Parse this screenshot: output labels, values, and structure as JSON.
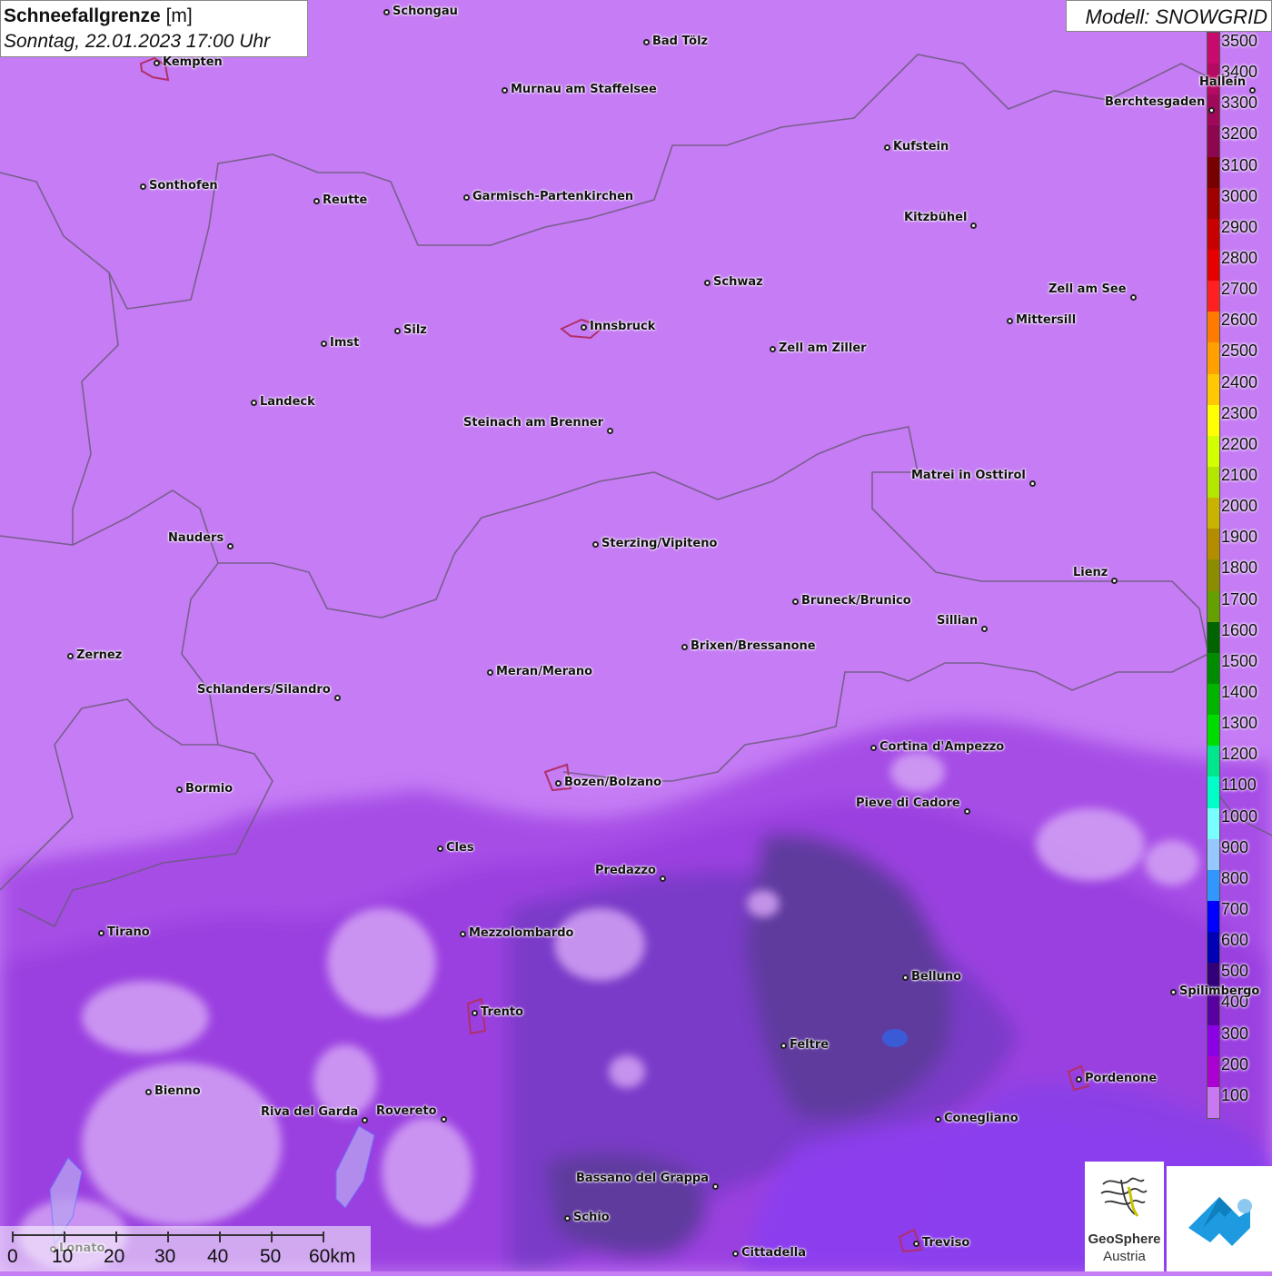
{
  "title": {
    "main": "Schneefallgrenze",
    "unit": "[m]",
    "datetime": "Sonntag, 22.01.2023 17:00 Uhr"
  },
  "model": "Modell: SNOWGRID",
  "legend": {
    "labels": [
      "3500",
      "3400",
      "3300",
      "3200",
      "3100",
      "3000",
      "2900",
      "2800",
      "2700",
      "2600",
      "2500",
      "2400",
      "2300",
      "2200",
      "2100",
      "2000",
      "1900",
      "1800",
      "1700",
      "1600",
      "1500",
      "1400",
      "1300",
      "1200",
      "1100",
      "1000",
      "900",
      "800",
      "700",
      "600",
      "500",
      "400",
      "300",
      "200",
      "100"
    ],
    "colors": [
      "#c80a6e",
      "#b40a64",
      "#a0085a",
      "#8c0650",
      "#780000",
      "#a00000",
      "#c80000",
      "#e60000",
      "#ff2020",
      "#ff7a00",
      "#ffa000",
      "#ffc800",
      "#ffff00",
      "#d4ff00",
      "#b4e600",
      "#c8b400",
      "#b48c00",
      "#8c8c00",
      "#64a000",
      "#006400",
      "#008c00",
      "#00b400",
      "#00dc00",
      "#00e68c",
      "#00ffc8",
      "#78ffff",
      "#96c8ff",
      "#3296ff",
      "#0000ff",
      "#0000b4",
      "#320078",
      "#5a00a0",
      "#8c00e6",
      "#aa00d2",
      "#c878f0"
    ]
  },
  "scale": {
    "labels": [
      "0",
      "10",
      "20",
      "30",
      "40",
      "50",
      "60km"
    ]
  },
  "logo": {
    "line1": "GeoSphere",
    "line2": "Austria"
  },
  "cities": [
    {
      "name": "Schongau"
    },
    {
      "name": "Kempten"
    },
    {
      "name": "Bad Tölz"
    },
    {
      "name": "Murnau am Staffelsee"
    },
    {
      "name": "Berchtesgaden"
    },
    {
      "name": "Hallein"
    },
    {
      "name": "Kufstein"
    },
    {
      "name": "Sonthofen"
    },
    {
      "name": "Reutte"
    },
    {
      "name": "Garmisch-Partenkirchen"
    },
    {
      "name": "Kitzbühel"
    },
    {
      "name": "Schwaz"
    },
    {
      "name": "Zell am See"
    },
    {
      "name": "Innsbruck"
    },
    {
      "name": "Mittersill"
    },
    {
      "name": "Imst"
    },
    {
      "name": "Silz"
    },
    {
      "name": "Zell am Ziller"
    },
    {
      "name": "Landeck"
    },
    {
      "name": "Steinach am Brenner"
    },
    {
      "name": "Matrei in Osttirol"
    },
    {
      "name": "Nauders"
    },
    {
      "name": "Sterzing/Vipiteno"
    },
    {
      "name": "Lienz"
    },
    {
      "name": "Bruneck/Brunico"
    },
    {
      "name": "Zernez"
    },
    {
      "name": "Brixen/Bressanone"
    },
    {
      "name": "Sillian"
    },
    {
      "name": "Meran/Merano"
    },
    {
      "name": "Schlanders/Silandro"
    },
    {
      "name": "Cortina d'Ampezzo"
    },
    {
      "name": "Bozen/Bolzano"
    },
    {
      "name": "Bormio"
    },
    {
      "name": "Pieve di Cadore"
    },
    {
      "name": "Cles"
    },
    {
      "name": "Predazzo"
    },
    {
      "name": "Tirano"
    },
    {
      "name": "Mezzolombardo"
    },
    {
      "name": "Belluno"
    },
    {
      "name": "Spilimbergo"
    },
    {
      "name": "Trento"
    },
    {
      "name": "Feltre"
    },
    {
      "name": "Pordenone"
    },
    {
      "name": "Bienno"
    },
    {
      "name": "Riva del Garda"
    },
    {
      "name": "Rovereto"
    },
    {
      "name": "Conegliano"
    },
    {
      "name": "Bassano del Grappa"
    },
    {
      "name": "Schio"
    },
    {
      "name": "Treviso"
    },
    {
      "name": "Cittadella"
    },
    {
      "name": "Lonato"
    }
  ]
}
